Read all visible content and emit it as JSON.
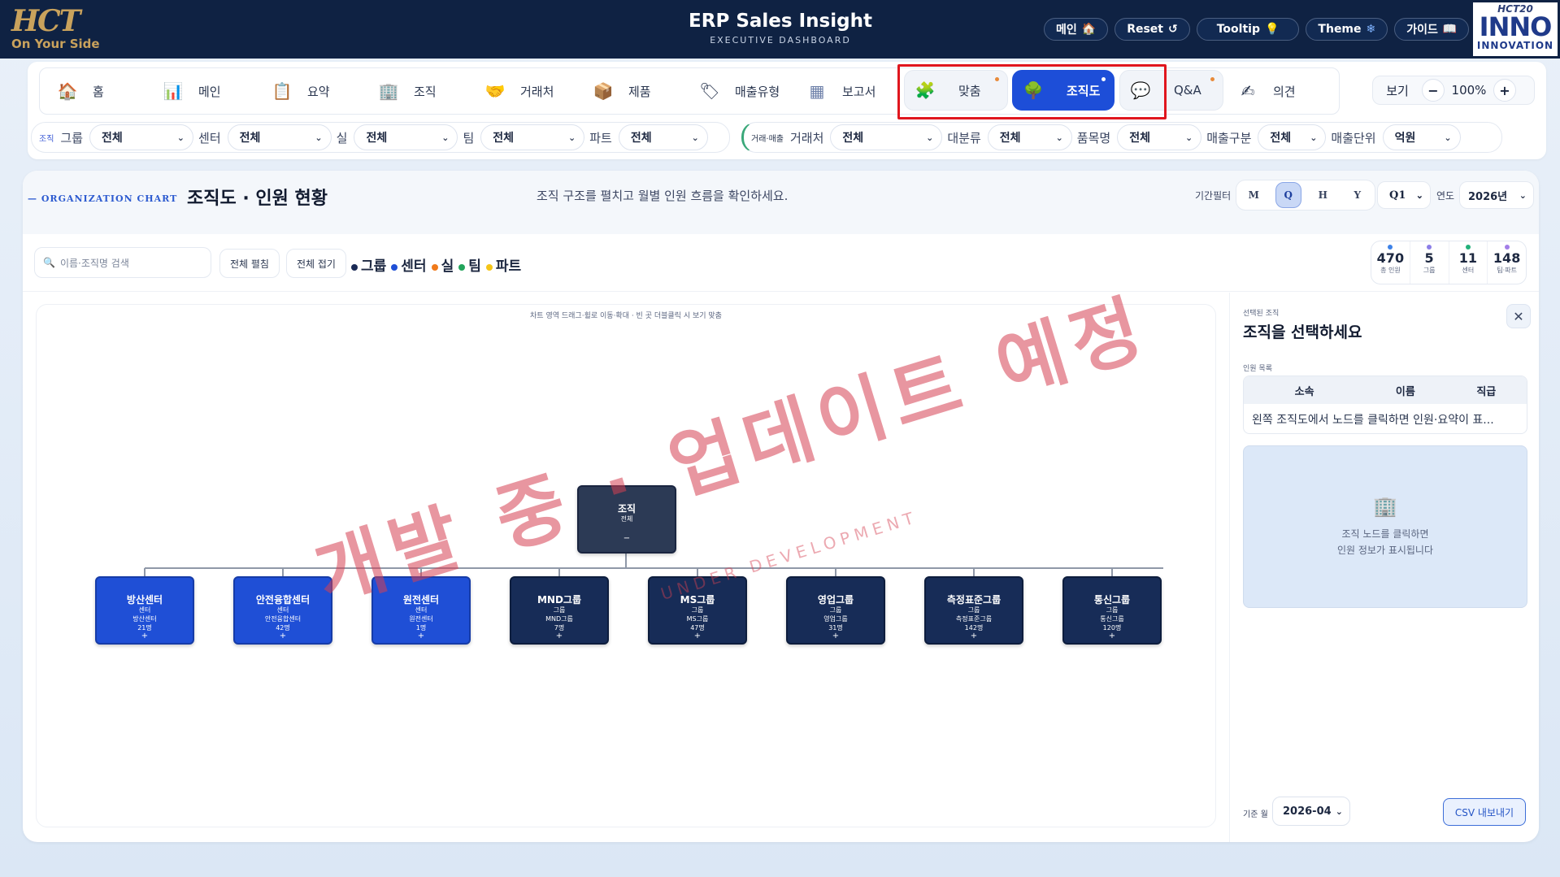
{
  "brand": {
    "logo": "HCT",
    "slogan": "On Your Side"
  },
  "app": {
    "title": "ERP Sales Insight",
    "subtitle": "EXECUTIVE DASHBOARD"
  },
  "top_buttons": [
    {
      "label": "메인",
      "icon": "🏠"
    },
    {
      "label": "Reset",
      "icon": "↺"
    },
    {
      "label": "Tooltip",
      "icon": "💡"
    },
    {
      "label": "Theme",
      "icon": "❄"
    },
    {
      "label": "가이드",
      "icon": "📖"
    }
  ],
  "badge": {
    "top": "HCT20",
    "main": "INNO",
    "bottom": "INNOVATION"
  },
  "nav": [
    {
      "label": "홈",
      "icon": "🏠"
    },
    {
      "label": "메인",
      "icon": "📊"
    },
    {
      "label": "요약",
      "icon": "📋"
    },
    {
      "label": "조직",
      "icon": "🏢"
    },
    {
      "label": "거래처",
      "icon": "🤝"
    },
    {
      "label": "제품",
      "icon": "📦"
    },
    {
      "label": "매출유형",
      "icon": "🏷"
    },
    {
      "label": "보고서",
      "icon": "▦"
    },
    {
      "label": "맞춤",
      "icon": "🧩"
    },
    {
      "label": "조직도",
      "icon": "🌳",
      "active": true
    },
    {
      "label": "Q&A",
      "icon": "💬"
    },
    {
      "label": "의견",
      "icon": "✍"
    }
  ],
  "zoom": {
    "label": "보기",
    "minus": "−",
    "value": "100%",
    "plus": "+"
  },
  "filters": {
    "org_tag": "조직",
    "org": [
      {
        "label": "그룹",
        "value": "전체"
      },
      {
        "label": "센터",
        "value": "전체"
      },
      {
        "label": "실",
        "value": "전체"
      },
      {
        "label": "팀",
        "value": "전체"
      },
      {
        "label": "파트",
        "value": "전체"
      }
    ],
    "sales_tag": "거래·매출",
    "sales": [
      {
        "label": "거래처",
        "value": "전체"
      },
      {
        "label": "대분류",
        "value": "전체"
      },
      {
        "label": "품목명",
        "value": "전체"
      },
      {
        "label": "매출구분",
        "value": "전체"
      },
      {
        "label": "매출단위",
        "value": "억원"
      }
    ]
  },
  "section": {
    "tag": "ORGANIZATION CHART",
    "title": "조직도 · 인원 현황",
    "desc": "조직 구조를 펼치고 월별 인원 흐름을 확인하세요.",
    "period_label": "기간필터",
    "periods": [
      "M",
      "Q",
      "H",
      "Y"
    ],
    "active_period": "Q",
    "quarter": "Q1",
    "year_label": "연도",
    "year": "2026년"
  },
  "toolbar": {
    "search_placeholder": "이름·조직명 검색",
    "expand_all": "전체 펼침",
    "collapse_all": "전체 접기",
    "legend": [
      {
        "label": "그룹",
        "color": "#1a2a55"
      },
      {
        "label": "센터",
        "color": "#1f4fd6"
      },
      {
        "label": "실",
        "color": "#f07a1a"
      },
      {
        "label": "팀",
        "color": "#22a45b"
      },
      {
        "label": "파트",
        "color": "#f5c518"
      }
    ]
  },
  "stats": [
    {
      "value": "470",
      "label": "총 인원",
      "color": "#3d82e8"
    },
    {
      "value": "5",
      "label": "그룹",
      "color": "#8c7ee8"
    },
    {
      "value": "11",
      "label": "센터",
      "color": "#22b07a"
    },
    {
      "value": "148",
      "label": "팀·파트",
      "color": "#a27ee8"
    }
  ],
  "chart": {
    "hint": "차트 영역 드래그·휠로 이동·확대 · 빈 곳 더블클릭 시 보기 맞춤",
    "watermark": "개발 중 · 업데이트 예정",
    "watermark_sub": "UNDER DEVELOPMENT",
    "root": {
      "name": "조직",
      "sub": "전체",
      "toggle": "−"
    },
    "nodes": [
      {
        "name": "방산센터",
        "type": "센터",
        "unit": "방산센터",
        "count": "21명",
        "style": "blue"
      },
      {
        "name": "안전융합센터",
        "type": "센터",
        "unit": "안전융합센터",
        "count": "42명",
        "style": "blue"
      },
      {
        "name": "원전센터",
        "type": "센터",
        "unit": "원전센터",
        "count": "1명",
        "style": "blue"
      },
      {
        "name": "MND그룹",
        "type": "그룹",
        "unit": "MND그룹",
        "count": "7명",
        "style": "navy"
      },
      {
        "name": "MS그룹",
        "type": "그룹",
        "unit": "MS그룹",
        "count": "47명",
        "style": "navy"
      },
      {
        "name": "영업그룹",
        "type": "그룹",
        "unit": "영업그룹",
        "count": "31명",
        "style": "navy"
      },
      {
        "name": "측정표준그룹",
        "type": "그룹",
        "unit": "측정표준그룹",
        "count": "142명",
        "style": "navy"
      },
      {
        "name": "통신그룹",
        "type": "그룹",
        "unit": "통신그룹",
        "count": "120명",
        "style": "navy"
      }
    ]
  },
  "side": {
    "selected_label": "선택된 조직",
    "selected_title": "조직을 선택하세요",
    "close": "✕",
    "members_label": "인원 목록",
    "columns": [
      "소속",
      "이름",
      "직급"
    ],
    "empty_row": "왼쪽 조직도에서 노드를 클릭하면 인원·요약이 표...",
    "info_line1": "조직 노드를 클릭하면",
    "info_line2": "인원 정보가 표시됩니다",
    "base_month_label": "기준 월",
    "base_month": "2026-04",
    "csv": "CSV 내보내기"
  }
}
